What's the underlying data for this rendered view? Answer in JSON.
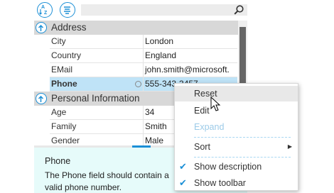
{
  "toolbar": {
    "sort_icon": "sort-alphabetical-icon",
    "categorize_icon": "categorized-list-icon",
    "search_placeholder": "",
    "search_icon": "magnifier-icon"
  },
  "categories": [
    {
      "label": "Address",
      "rows": [
        {
          "name": "City",
          "value": "London"
        },
        {
          "name": "Country",
          "value": "England"
        },
        {
          "name": "EMail",
          "value": "john.smith@microsoft."
        },
        {
          "name": "Phone",
          "value": "555-343-3457",
          "selected": true
        }
      ]
    },
    {
      "label": "Personal Information",
      "rows": [
        {
          "name": "Age",
          "value": "34"
        },
        {
          "name": "Family",
          "value": "Smith"
        },
        {
          "name": "Gender",
          "value": "Male"
        }
      ]
    }
  ],
  "description": {
    "title": "Phone",
    "text": "The Phone field should contain a valid phone number."
  },
  "context_menu": {
    "items": [
      {
        "label": "Reset",
        "highlighted": true
      },
      {
        "label": "Edit"
      },
      {
        "label": "Expand",
        "disabled": true
      },
      {
        "label": "Sort",
        "submenu": true
      },
      {
        "label": "Show description",
        "checked": true
      },
      {
        "label": "Show toolbar",
        "checked": true
      }
    ]
  },
  "colors": {
    "accent": "#1b8fd6",
    "selected_row": "#bfe3f7",
    "category_bg": "#d8d8d8",
    "description_bg": "#e6fbfa"
  }
}
